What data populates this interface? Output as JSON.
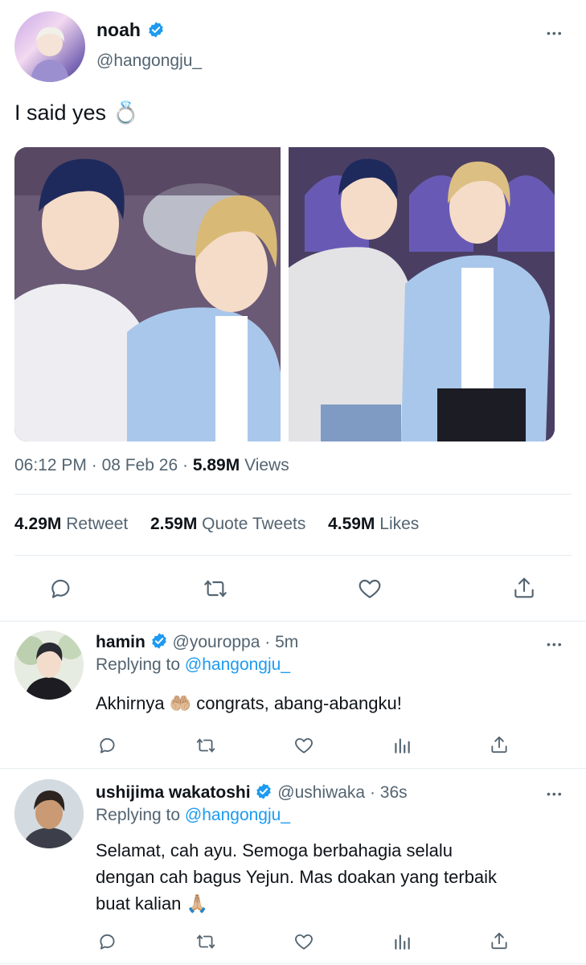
{
  "tweet": {
    "author_name": "noah",
    "author_handle": "@hangongju_",
    "text": "I said yes 💍",
    "time": "06:12 PM",
    "date": "08 Feb 26",
    "sep": "·",
    "views_count": "5.89M",
    "views_label": "Views",
    "retweets_count": "4.29M",
    "retweets_label": "Retweet",
    "quotes_count": "2.59M",
    "quotes_label": "Quote Tweets",
    "likes_count": "4.59M",
    "likes_label": "Likes",
    "more": "•••"
  },
  "replies": [
    {
      "name": "hamin",
      "handle": "@youroppa",
      "time": "· 5m",
      "replying_label": "Replying to",
      "replying_to": "@hangongju_",
      "text": "Akhirnya 🤲🏼 congrats, abang-abangku!",
      "more": "•••"
    },
    {
      "name": "ushijima wakatoshi",
      "handle": "@ushiwaka",
      "time": "· 36s",
      "replying_label": "Replying to",
      "replying_to": "@hangongju_",
      "text_line1": "Selamat, cah ayu. Semoga berbahagia selalu",
      "text_line2": "dengan cah bagus Yejun. Mas doakan yang terbaik",
      "text_line3": "buat kalian 🙏🏼",
      "more": "•••"
    }
  ],
  "colors": {
    "accent": "#1d9bf0",
    "muted": "#536471",
    "divider": "#e6ecf0"
  },
  "icons": [
    "reply-icon",
    "retweet-icon",
    "like-icon",
    "share-icon",
    "analytics-icon",
    "verified-icon",
    "more-icon"
  ]
}
